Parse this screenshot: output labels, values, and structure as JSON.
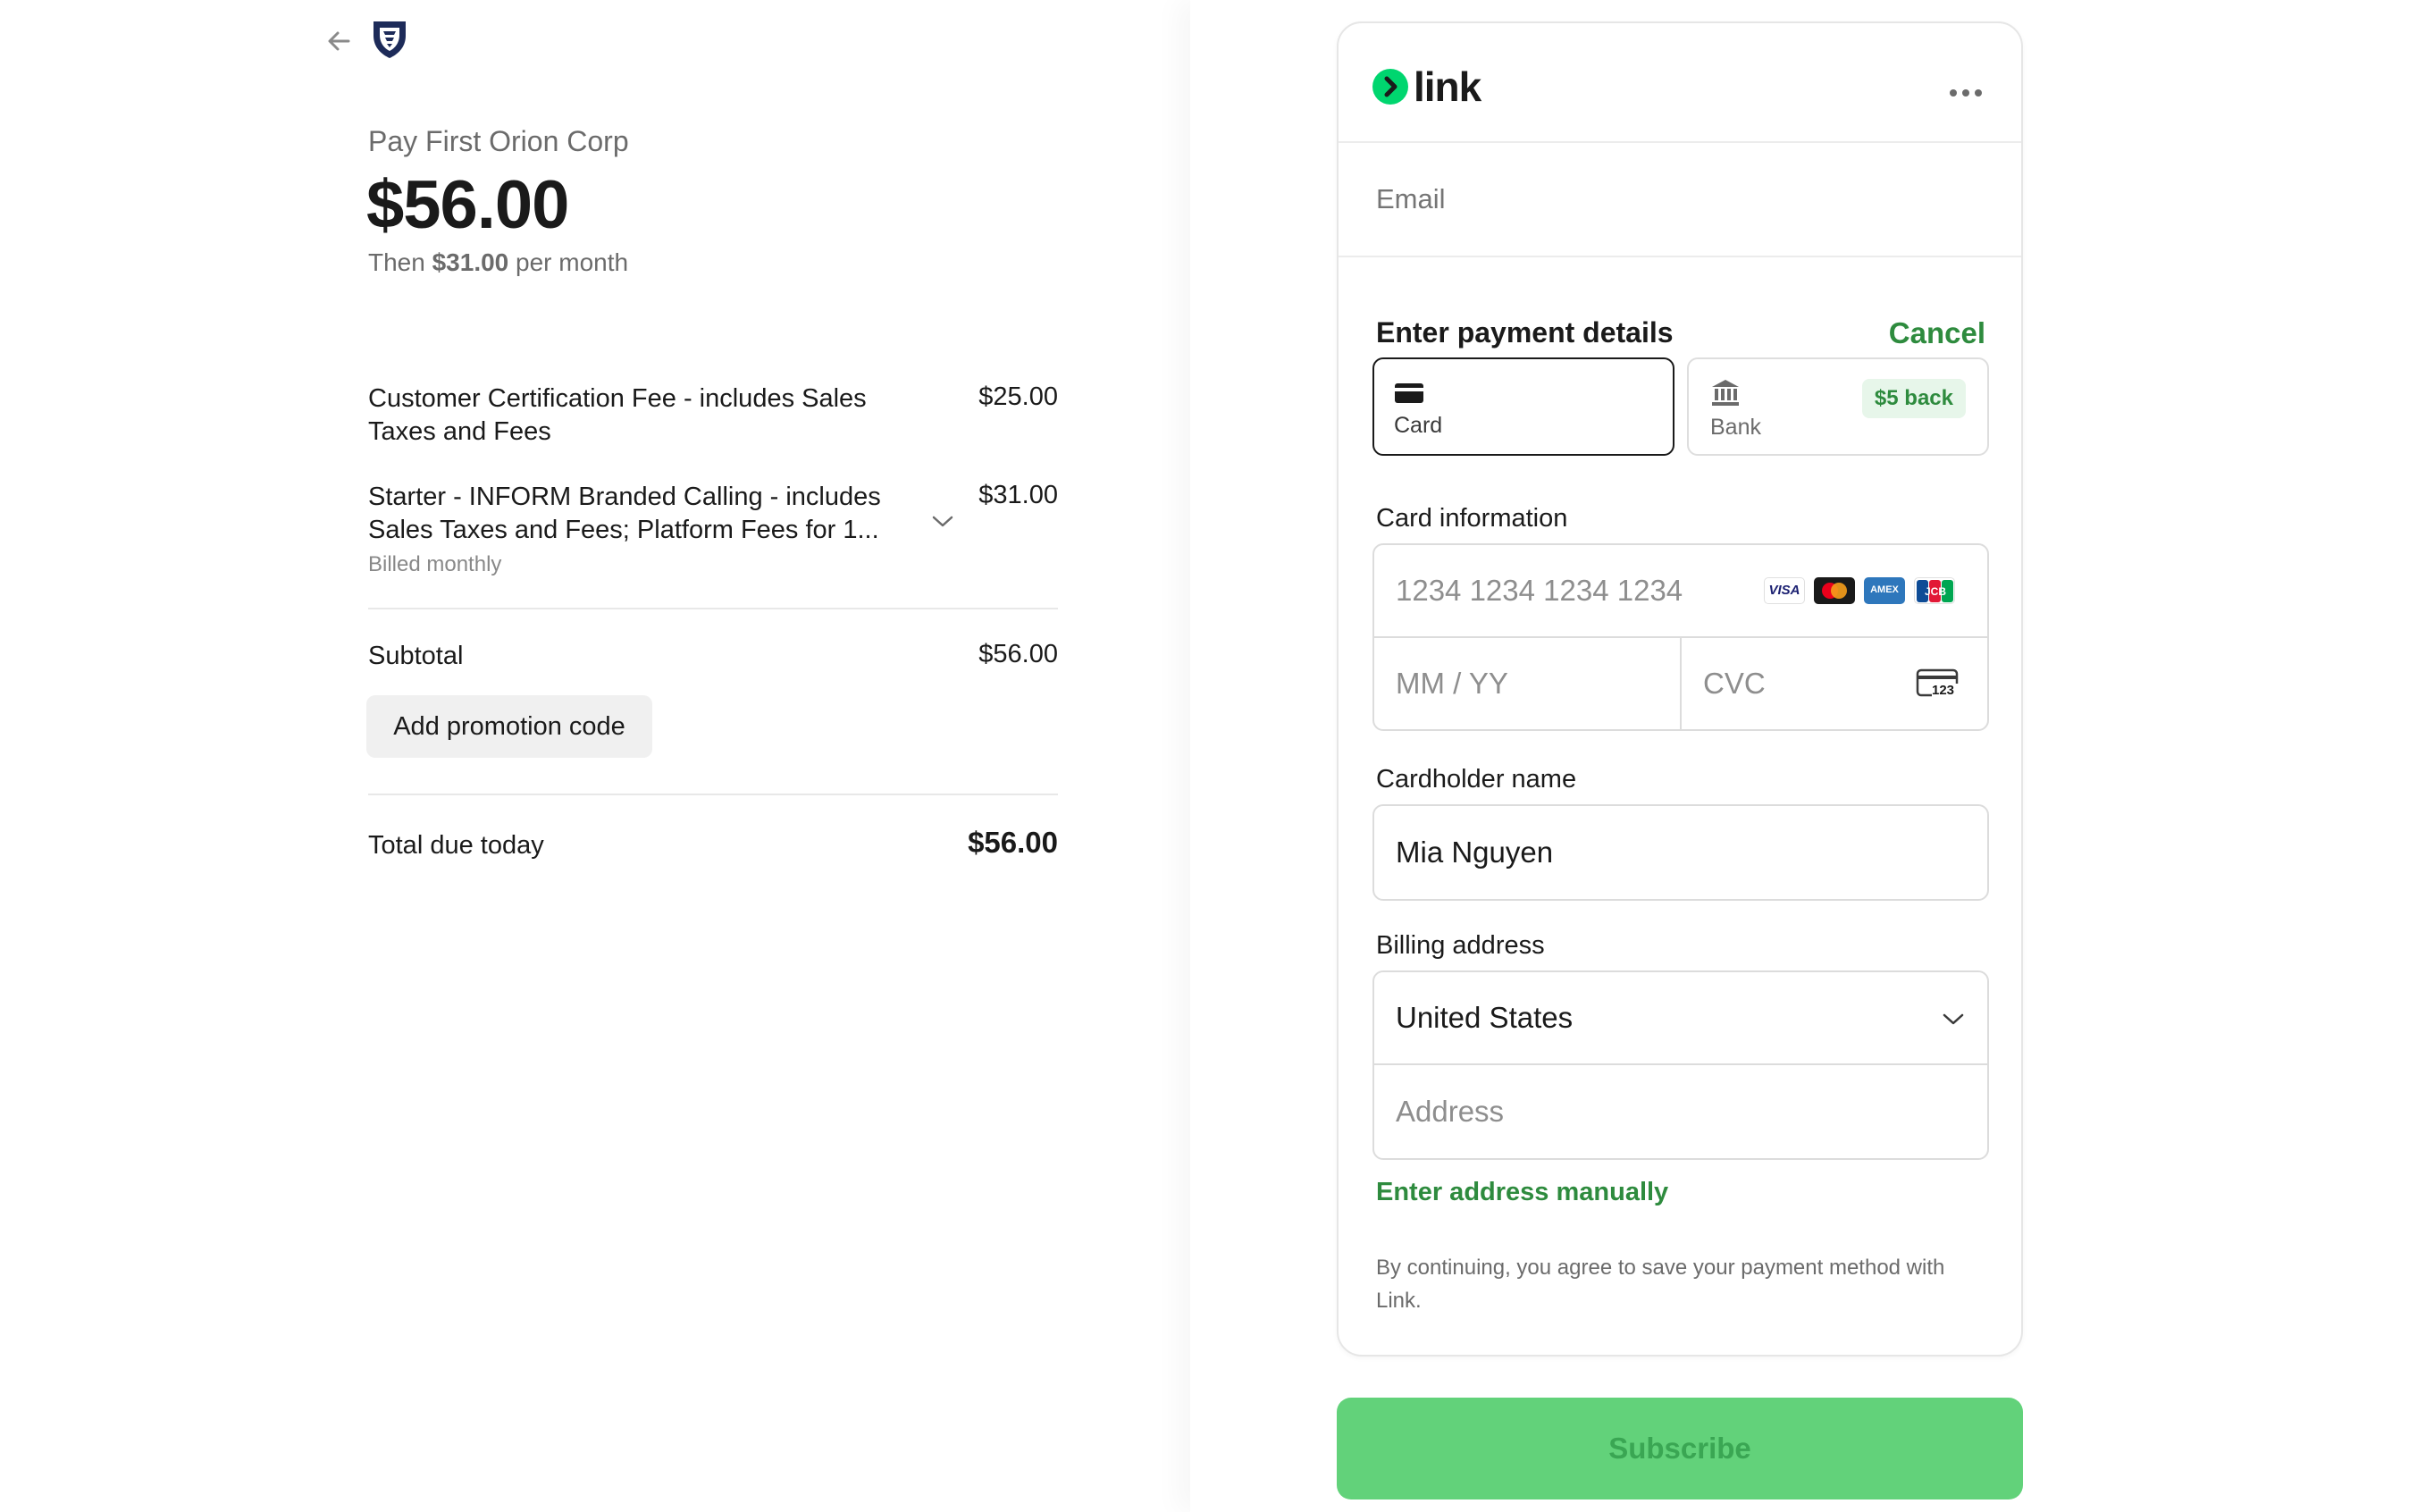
{
  "merchant": {
    "pay_label": "Pay First Orion Corp",
    "amount": "$56.00",
    "then_prefix": "Then ",
    "then_amount": "$31.00",
    "then_suffix": " per month"
  },
  "line_items": [
    {
      "name_line1": "Customer Certification Fee - includes Sales",
      "name_line2": "Taxes and Fees",
      "price": "$25.00"
    },
    {
      "name_line1": "Starter - INFORM Branded Calling - includes",
      "name_line2": "Sales Taxes and Fees; Platform Fees for 1...",
      "price": "$31.00",
      "sub": "Billed monthly"
    }
  ],
  "summary": {
    "subtotal_label": "Subtotal",
    "subtotal_value": "$56.00",
    "promo_label": "Add promotion code",
    "total_label": "Total due today",
    "total_value": "$56.00"
  },
  "link": {
    "logo_text": "link",
    "email_placeholder": "Email",
    "section_title": "Enter payment details",
    "cancel": "Cancel",
    "tabs": {
      "card": "Card",
      "bank": "Bank",
      "bank_badge": "$5 back"
    },
    "card_info_label": "Card information",
    "card_number_placeholder": "1234 1234 1234 1234",
    "expiry_placeholder": "MM / YY",
    "cvc_placeholder": "CVC",
    "cvc_icon_text": "123",
    "brands": [
      "VISA",
      "mastercard",
      "AMEX",
      "JCB"
    ],
    "cardholder_label": "Cardholder name",
    "cardholder_value": "Mia Nguyen",
    "billing_label": "Billing address",
    "country_value": "United States",
    "address_placeholder": "Address",
    "manual_link": "Enter address manually",
    "consent": "By continuing, you agree to save your payment method with Link."
  },
  "subscribe_label": "Subscribe",
  "colors": {
    "link_green": "#00d66f",
    "accent_green": "#2e8b3e",
    "subscribe_bg": "#62d27a",
    "brand_navy": "#1d2b59"
  }
}
